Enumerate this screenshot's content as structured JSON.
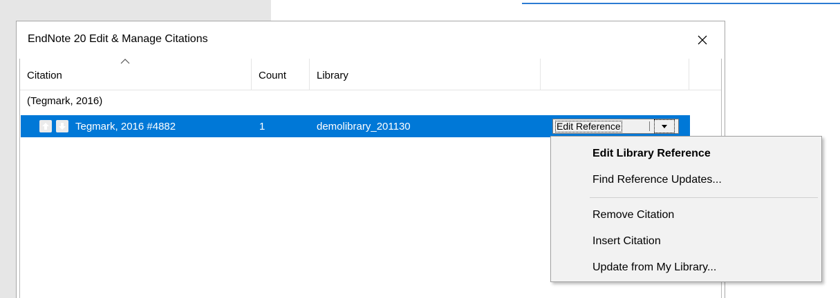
{
  "dialog": {
    "title": "EndNote 20 Edit & Manage Citations"
  },
  "columns": {
    "citation": "Citation",
    "count": "Count",
    "library": "Library"
  },
  "group": {
    "label": "(Tegmark, 2016)"
  },
  "row": {
    "citation": "Tegmark, 2016 #4882",
    "count": "1",
    "library": "demolibrary_201130",
    "action_label": "Edit Reference"
  },
  "menu": {
    "items": [
      {
        "label": "Edit Library Reference"
      },
      {
        "label": "Find Reference Updates..."
      },
      {
        "label": "Remove Citation"
      },
      {
        "label": "Insert Citation"
      },
      {
        "label": "Update from My Library..."
      }
    ]
  },
  "colors": {
    "selection": "#0078d7",
    "menu_bg": "#f2f2f2",
    "doc_accent": "#2b7cd3"
  },
  "icons": {
    "close": "close-icon",
    "sort": "sort-ascending-icon",
    "move_up": "arrow-up-icon",
    "move_down": "arrow-down-icon",
    "dropdown": "chevron-down-icon"
  }
}
